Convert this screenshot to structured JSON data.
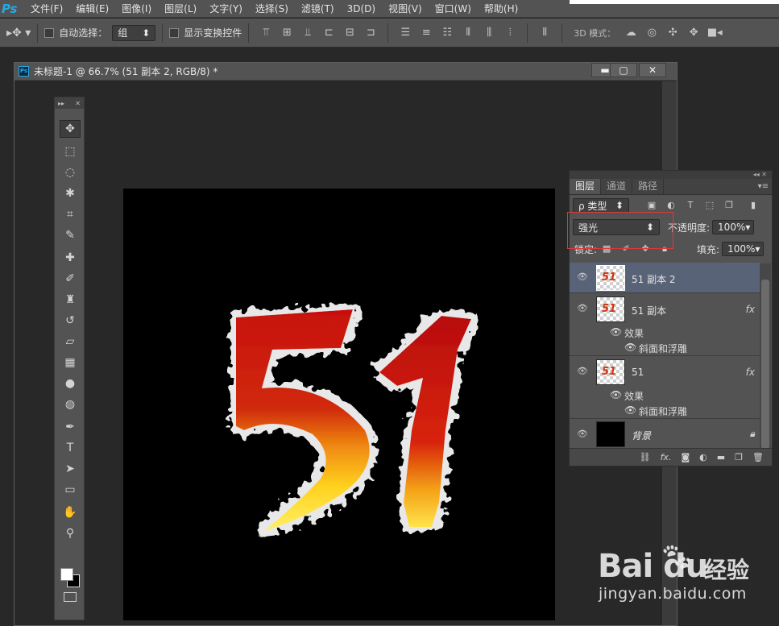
{
  "app": {
    "logo": "Ps"
  },
  "menu": [
    "文件(F)",
    "编辑(E)",
    "图像(I)",
    "图层(L)",
    "文字(Y)",
    "选择(S)",
    "滤镜(T)",
    "3D(D)",
    "视图(V)",
    "窗口(W)",
    "帮助(H)"
  ],
  "options": {
    "auto_select_label": "自动选择：",
    "auto_select_value": "组",
    "show_transform_label": "显示变换控件",
    "mode_3d_label": "3D 模式："
  },
  "document": {
    "title": "未标题-1 @ 66.7% (51 副本 2, RGB/8) *",
    "btn_minimize": "▬",
    "btn_restore": "▢",
    "btn_close": "✕"
  },
  "canvas_art": {
    "text": "51",
    "background": "#000000"
  },
  "tools_panel": {
    "header_left": "▸▸",
    "header_right": "✕",
    "tools": [
      {
        "name": "move-tool",
        "glyph": "✥"
      },
      {
        "name": "marquee-tool",
        "glyph": "⬚"
      },
      {
        "name": "lasso-tool",
        "glyph": "◌"
      },
      {
        "name": "magic-wand-tool",
        "glyph": "✱"
      },
      {
        "name": "crop-tool",
        "glyph": "⌗"
      },
      {
        "name": "eyedropper-tool",
        "glyph": "✎"
      },
      {
        "name": "healing-brush-tool",
        "glyph": "✚"
      },
      {
        "name": "brush-tool",
        "glyph": "✐"
      },
      {
        "name": "clone-stamp-tool",
        "glyph": "♜"
      },
      {
        "name": "history-brush-tool",
        "glyph": "↺"
      },
      {
        "name": "eraser-tool",
        "glyph": "▱"
      },
      {
        "name": "gradient-tool",
        "glyph": "▦"
      },
      {
        "name": "blur-tool",
        "glyph": "●"
      },
      {
        "name": "dodge-tool",
        "glyph": "◍"
      },
      {
        "name": "pen-tool",
        "glyph": "✒"
      },
      {
        "name": "type-tool",
        "glyph": "T"
      },
      {
        "name": "path-selection-tool",
        "glyph": "➤"
      },
      {
        "name": "rectangle-tool",
        "glyph": "▭"
      },
      {
        "name": "hand-tool",
        "glyph": "✋"
      },
      {
        "name": "zoom-tool",
        "glyph": "⚲"
      }
    ]
  },
  "layers_panel": {
    "top_arrows": "◂◂  ✕",
    "tabs": [
      "图层",
      "通道",
      "路径"
    ],
    "menu_glyph": "▾≡",
    "filter_kind": "ρ 类型",
    "blend_mode": "强光",
    "opacity_label": "不透明度:",
    "opacity_value": "100%",
    "lock_label": "锁定:",
    "fill_label": "填充:",
    "fill_value": "100%",
    "layers": [
      {
        "name": "51 副本 2",
        "selected": true,
        "fx": ""
      },
      {
        "name": "51 副本",
        "selected": false,
        "fx": "fx",
        "effects_label": "效果",
        "effect": "斜面和浮雕"
      },
      {
        "name": "51",
        "selected": false,
        "fx": "fx",
        "effects_label": "效果",
        "effect": "斜面和浮雕"
      },
      {
        "name": "背景",
        "selected": false,
        "fx": "",
        "locked": true
      }
    ]
  },
  "watermark": {
    "brand": "Bai  du",
    "product": "经验",
    "url": "jingyan.baidu.com"
  },
  "colors": {
    "accent_blue": "#29a8e0",
    "highlight_red": "#e0383a",
    "selected_layer": "#596378"
  }
}
